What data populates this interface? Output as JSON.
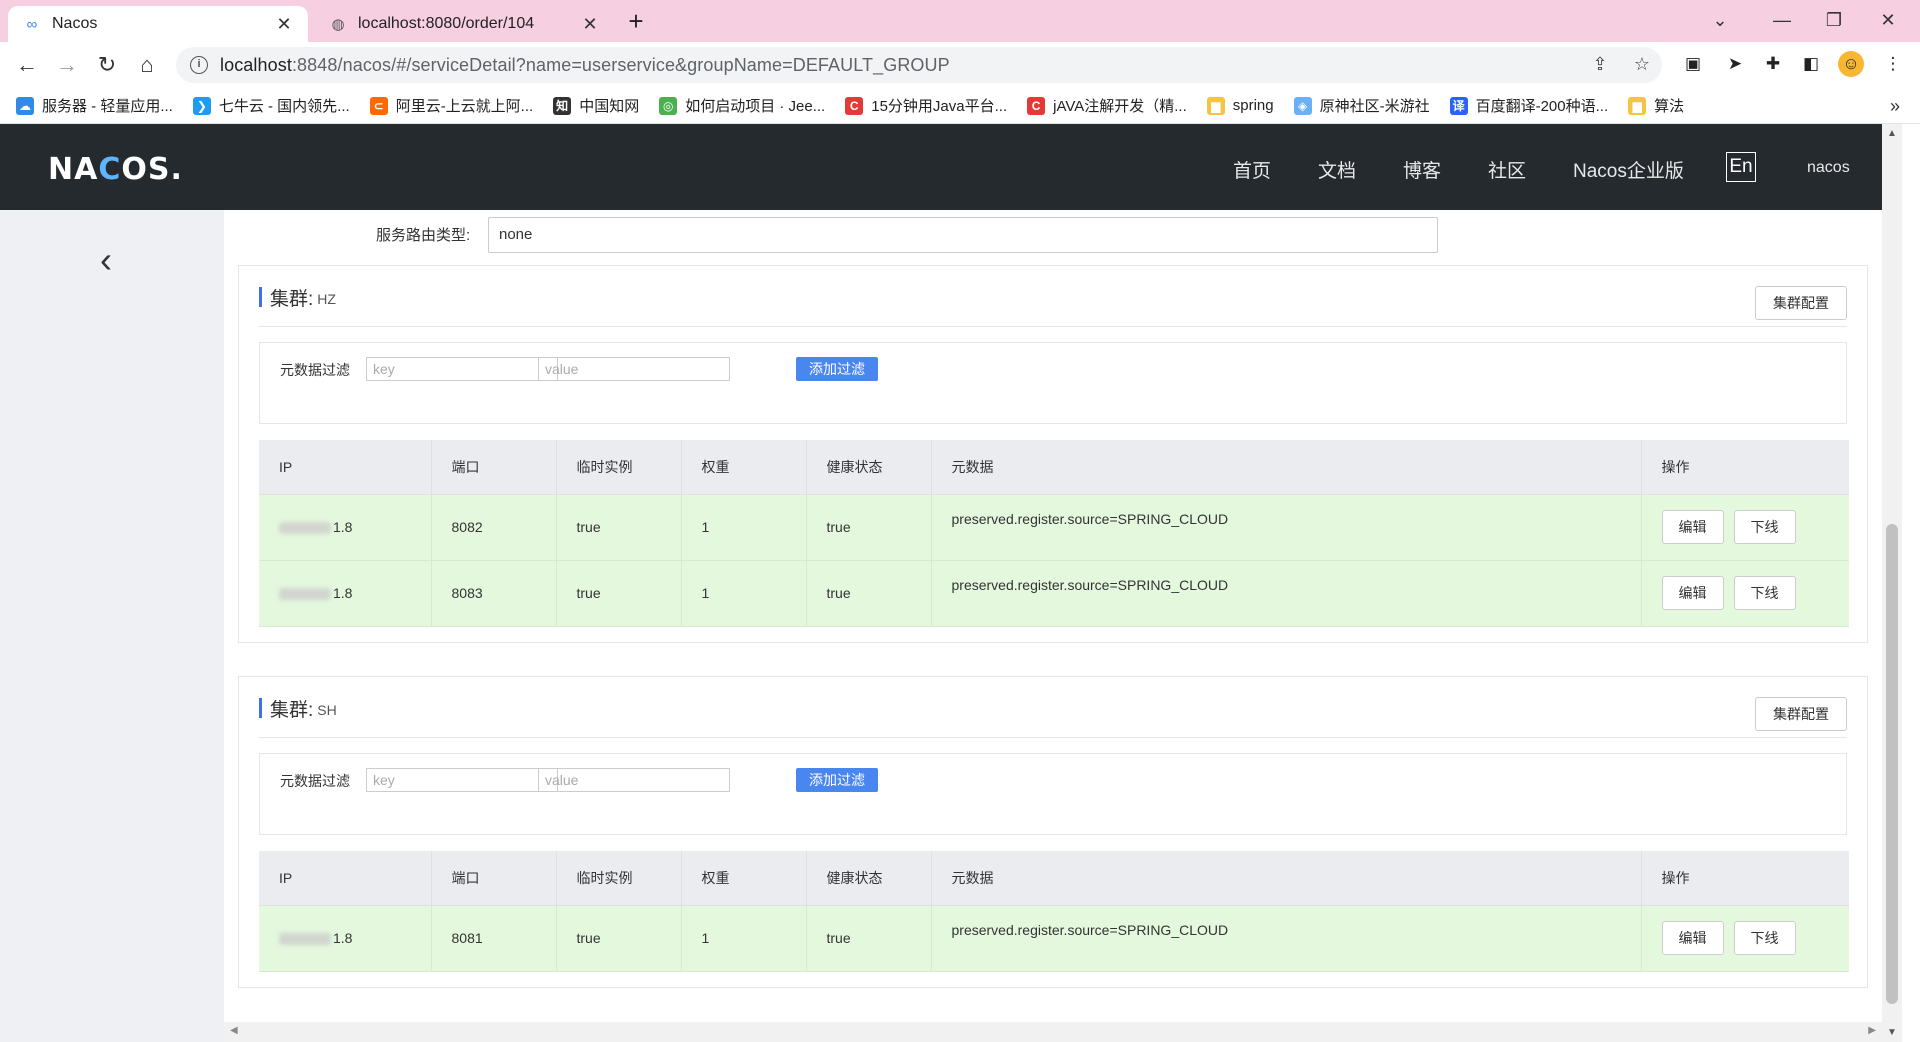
{
  "tabs": [
    {
      "title": "Nacos",
      "icon": "∞"
    },
    {
      "title": "localhost:8080/order/104",
      "icon": "◍"
    }
  ],
  "address_bar": {
    "host": "localhost",
    "rest": ":8848/nacos/#/serviceDetail?name=userservice&groupName=DEFAULT_GROUP"
  },
  "bookmarks": [
    {
      "label": "服务器 - 轻量应用...",
      "color": "#2f8be6",
      "icon": "☁"
    },
    {
      "label": "七牛云 - 国内领先...",
      "color": "#1f9cf0",
      "icon": "❯"
    },
    {
      "label": "阿里云-上云就上阿...",
      "color": "#ff6a00",
      "icon": "⊂"
    },
    {
      "label": "中国知网",
      "color": "#333333",
      "icon": "知"
    },
    {
      "label": "如何启动项目 · Jee...",
      "color": "#4caf50",
      "icon": "◎"
    },
    {
      "label": "15分钟用Java平台...",
      "color": "#e53935",
      "icon": "C"
    },
    {
      "label": "jAVA注解开发（精...",
      "color": "#e53935",
      "icon": "C"
    },
    {
      "label": "spring",
      "color": "#f5c542",
      "icon": "▆"
    },
    {
      "label": "原神社区-米游社",
      "color": "#6ab0f5",
      "icon": "◈"
    },
    {
      "label": "百度翻译-200种语...",
      "color": "#2962ff",
      "icon": "译"
    },
    {
      "label": "算法",
      "color": "#f5c542",
      "icon": "▆"
    }
  ],
  "nacos": {
    "logo_pre": "NA",
    "logo_o": "C",
    "logo_post": "OS.",
    "nav": [
      "首页",
      "文档",
      "博客",
      "社区",
      "Nacos企业版"
    ],
    "lang": "En",
    "user": "nacos"
  },
  "route": {
    "label": "服务路由类型:",
    "value": "none"
  },
  "common": {
    "cluster_label": "集群:",
    "cluster_config": "集群配置",
    "filter_label": "元数据过滤",
    "key_placeholder": "key",
    "value_placeholder": "value",
    "add_filter": "添加过滤",
    "columns": [
      "IP",
      "端口",
      "临时实例",
      "权重",
      "健康状态",
      "元数据",
      "操作"
    ],
    "edit": "编辑",
    "offline": "下线"
  },
  "clusters": [
    {
      "name": "HZ",
      "rows": [
        {
          "ip_suffix": "1.8",
          "port": "8082",
          "ephemeral": "true",
          "weight": "1",
          "healthy": "true",
          "metadata": "preserved.register.source=SPRING_CLOUD"
        },
        {
          "ip_suffix": "1.8",
          "port": "8083",
          "ephemeral": "true",
          "weight": "1",
          "healthy": "true",
          "metadata": "preserved.register.source=SPRING_CLOUD"
        }
      ]
    },
    {
      "name": "SH",
      "rows": [
        {
          "ip_suffix": "1.8",
          "port": "8081",
          "ephemeral": "true",
          "weight": "1",
          "healthy": "true",
          "metadata": "preserved.register.source=SPRING_CLOUD"
        }
      ]
    }
  ]
}
